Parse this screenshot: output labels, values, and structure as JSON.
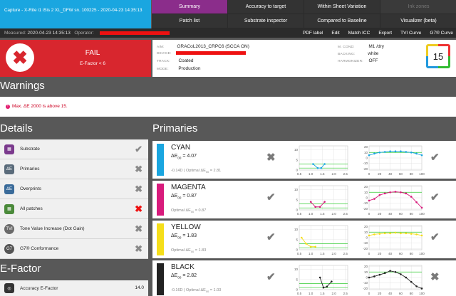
{
  "header": {
    "capture_title": "Capture - X-Rite i1 iSis 2 XL_DFW sn. 100225 - 2020-04-23 14:35:13",
    "nav": [
      {
        "label": "Summary",
        "state": "active"
      },
      {
        "label": "Accuracy to target",
        "state": "normal"
      },
      {
        "label": "Within Sheet Variation",
        "state": "normal"
      },
      {
        "label": "Ink zones",
        "state": "disabled"
      },
      {
        "label": "Patch list",
        "state": "normal"
      },
      {
        "label": "Substrate inspector",
        "state": "normal"
      },
      {
        "label": "Compared to Baseline",
        "state": "normal"
      },
      {
        "label": "Visualizer (beta)",
        "state": "normal"
      }
    ]
  },
  "meta": {
    "measured_label": "Measured:",
    "measured_value": "2020-04-23 14:35:13",
    "operator_label": "Operator:",
    "actions": [
      "PDF label",
      "Edit",
      "Match ICC",
      "Export",
      "TVI Curve",
      "G7® Curve"
    ]
  },
  "status": {
    "result": "FAIL",
    "efactor_condition": "E-Factor < 6",
    "aim_label": "AIM:",
    "aim_value": "GRACoL2013_CRPC6 (SCCA ON)",
    "device_label": "DEVICE:",
    "track_label": "TRACK:",
    "track_value": "Coated",
    "mode_label": "MODE:",
    "mode_value": "Production",
    "mcond_label": "M. COND:",
    "mcond_value": "M1 /dry",
    "backing_label": "BACKING:",
    "backing_value": "white",
    "harmonizer_label": "HARMONIZER:",
    "harmonizer_value": "OFF",
    "badge_number": "15"
  },
  "warnings": {
    "title": "Warnings",
    "message": "Max. ΔE 2000 is above 15."
  },
  "details": {
    "title": "Details",
    "items": [
      {
        "label": "Substrate",
        "result": "pass",
        "icon": "substrate-icon",
        "icon_color": "#7b3a8d"
      },
      {
        "label": "Primaries",
        "result": "fail",
        "icon": "primaries-icon",
        "icon_color": "#5a6b7a"
      },
      {
        "label": "Overprints",
        "result": "fail",
        "icon": "overprints-icon",
        "icon_color": "#3a6b9a"
      },
      {
        "label": "All patches",
        "result": "fail-red",
        "icon": "all-patches-icon",
        "icon_color": "#4a8a3a"
      },
      {
        "label": "Tone Value Increase (Dot Gain)",
        "result": "fail",
        "icon": "tvi-icon",
        "icon_color": "#6a6a6a"
      },
      {
        "label": "G7® Conformance",
        "result": "fail",
        "icon": "g7-icon",
        "icon_color": "#555555"
      }
    ]
  },
  "efactor": {
    "title": "E-Factor",
    "row_label": "Accuracy E-Factor",
    "row_value": "14.0"
  },
  "primaries": {
    "title": "Primaries",
    "items": [
      {
        "name": "CYAN",
        "swatch": "#1aa6e0",
        "de_label": "ΔE",
        "de_sub": "00",
        "de_value": "= 4.07",
        "note": "-0.14D | Optimal ΔE",
        "note_sub": "00",
        "note_value": " = 2.81",
        "status": "fail",
        "trend": "pass"
      },
      {
        "name": "MAGENTA",
        "swatch": "#d81b7c",
        "de_label": "ΔE",
        "de_sub": "00",
        "de_value": "= 0.87",
        "note": "Optimal ΔE",
        "note_sub": "00",
        "note_value": " = 0.87",
        "status": "pass",
        "trend": "pass"
      },
      {
        "name": "YELLOW",
        "swatch": "#f5de1a",
        "de_label": "ΔE",
        "de_sub": "00",
        "de_value": "= 1.83",
        "note": "Optimal ΔE",
        "note_sub": "00",
        "note_value": " = 1.83",
        "status": "pass",
        "trend": "pass"
      },
      {
        "name": "BLACK",
        "swatch": "#222222",
        "de_label": "ΔE",
        "de_sub": "00",
        "de_value": "= 2.82",
        "note": "-0.16D | Optimal ΔE",
        "note_sub": "00",
        "note_value": " = 1.03",
        "status": "pass",
        "trend": "fail"
      }
    ]
  },
  "chart_data": [
    {
      "type": "line",
      "name": "cyan-density",
      "x_ticks": [
        "0.5",
        "1.0",
        "1.5",
        "2.0",
        "2.5"
      ],
      "y_ticks": [
        "10",
        "5",
        "0"
      ],
      "color": "#1aa6e0",
      "x": [
        1.1,
        1.3,
        1.45,
        1.6
      ],
      "y": [
        3,
        1,
        1,
        3
      ]
    },
    {
      "type": "line",
      "name": "cyan-trend",
      "x_ticks": [
        "0",
        "20",
        "40",
        "60",
        "80",
        "100"
      ],
      "y_ticks": [
        "20",
        "10",
        "0",
        "-10",
        "-20"
      ],
      "color": "#1aa6e0",
      "x": [
        0,
        10,
        20,
        30,
        40,
        50,
        60,
        70,
        80,
        90,
        100
      ],
      "y": [
        5,
        8,
        10,
        11,
        12,
        12,
        12,
        11,
        10,
        8,
        5
      ]
    },
    {
      "type": "line",
      "name": "magenta-density",
      "x_ticks": [
        "0.5",
        "1.0",
        "1.5",
        "2.0",
        "2.5"
      ],
      "y_ticks": [
        "10",
        "5",
        "0"
      ],
      "color": "#d81b7c",
      "x": [
        1.0,
        1.2,
        1.4,
        1.6
      ],
      "y": [
        4,
        1.5,
        1.5,
        4
      ]
    },
    {
      "type": "line",
      "name": "magenta-trend",
      "x_ticks": [
        "0",
        "20",
        "40",
        "60",
        "80",
        "100"
      ],
      "y_ticks": [
        "20",
        "10",
        "0",
        "-10",
        "-20"
      ],
      "color": "#d81b7c",
      "x": [
        0,
        10,
        20,
        30,
        40,
        50,
        60,
        70,
        80,
        90,
        100
      ],
      "y": [
        -5,
        -2,
        5,
        8,
        10,
        11,
        10,
        8,
        2,
        -8,
        -18
      ]
    },
    {
      "type": "line",
      "name": "yellow-density",
      "x_ticks": [
        "0.5",
        "1.0",
        "1.5",
        "2.0",
        "2.5"
      ],
      "y_ticks": [
        "10",
        "5",
        "0"
      ],
      "color": "#f5de1a",
      "x": [
        0.6,
        0.8,
        1.0,
        1.2
      ],
      "y": [
        6,
        3,
        1.5,
        1.5
      ]
    },
    {
      "type": "line",
      "name": "yellow-trend",
      "x_ticks": [
        "0",
        "20",
        "40",
        "60",
        "80",
        "100"
      ],
      "y_ticks": [
        "20",
        "10",
        "0",
        "-10",
        "-20"
      ],
      "color": "#f5de1a",
      "x": [
        0,
        10,
        20,
        30,
        40,
        50,
        60,
        70,
        80,
        90,
        100
      ],
      "y": [
        4,
        6,
        7,
        8,
        8,
        9,
        8,
        8,
        7,
        6,
        4
      ]
    },
    {
      "type": "line",
      "name": "black-density",
      "x_ticks": [
        "0.5",
        "1.0",
        "1.5",
        "2.0",
        "2.5"
      ],
      "y_ticks": [
        "10",
        "5",
        "0"
      ],
      "color": "#222222",
      "x": [
        1.4,
        1.55,
        1.7,
        1.9
      ],
      "y": [
        6,
        1,
        1.5,
        4
      ]
    },
    {
      "type": "line",
      "name": "black-trend",
      "x_ticks": [
        "0",
        "20",
        "40",
        "60",
        "80",
        "100"
      ],
      "y_ticks": [
        "20",
        "10",
        "0",
        "-10",
        "-20"
      ],
      "color": "#222222",
      "x": [
        0,
        10,
        20,
        30,
        40,
        50,
        60,
        70,
        80,
        90,
        100
      ],
      "y": [
        0,
        2,
        5,
        8,
        12,
        10,
        6,
        0,
        -8,
        -16,
        -20
      ]
    }
  ]
}
